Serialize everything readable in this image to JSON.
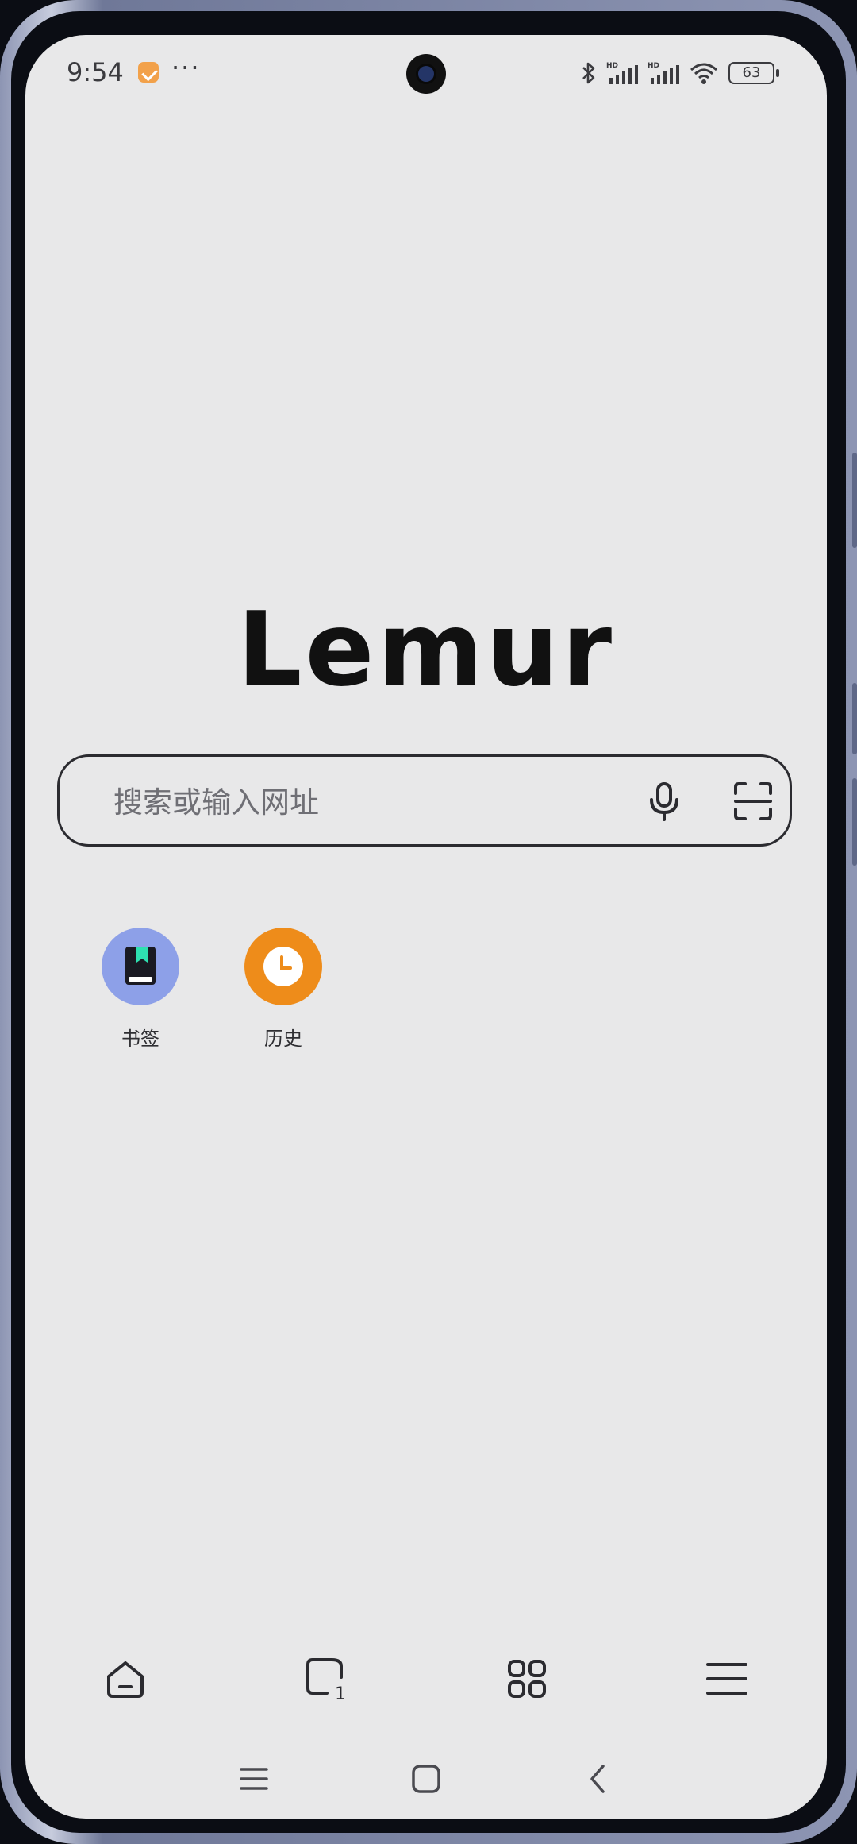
{
  "status_bar": {
    "time": "9:54",
    "more": "···",
    "battery": "63"
  },
  "logo_text": "Lemur",
  "search": {
    "placeholder": "搜索或输入网址"
  },
  "quick_links": [
    {
      "label": "书签",
      "icon": "bookmark-book-icon",
      "color": "#8da0e8"
    },
    {
      "label": "历史",
      "icon": "clock-icon",
      "color": "#ee8c1a"
    }
  ],
  "toolbar": {
    "tab_count": "1",
    "items": [
      "home-icon",
      "tabs-icon",
      "apps-grid-icon",
      "menu-icon"
    ]
  },
  "navbar": {
    "items": [
      "recents-icon",
      "home-square-icon",
      "back-icon"
    ]
  },
  "colors": {
    "screen_bg": "#e8e8e9",
    "text_dark": "#111111"
  }
}
